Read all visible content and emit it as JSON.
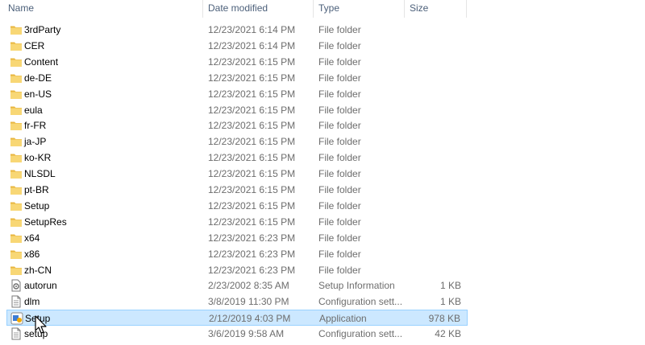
{
  "columns": {
    "name": "Name",
    "date_modified": "Date modified",
    "type": "Type",
    "size": "Size"
  },
  "files": [
    {
      "name": "3rdParty",
      "date": "12/23/2021 6:14 PM",
      "type": "File folder",
      "size": "",
      "icon": "folder-icon"
    },
    {
      "name": "CER",
      "date": "12/23/2021 6:14 PM",
      "type": "File folder",
      "size": "",
      "icon": "folder-icon"
    },
    {
      "name": "Content",
      "date": "12/23/2021 6:15 PM",
      "type": "File folder",
      "size": "",
      "icon": "folder-icon"
    },
    {
      "name": "de-DE",
      "date": "12/23/2021 6:15 PM",
      "type": "File folder",
      "size": "",
      "icon": "folder-icon"
    },
    {
      "name": "en-US",
      "date": "12/23/2021 6:15 PM",
      "type": "File folder",
      "size": "",
      "icon": "folder-icon"
    },
    {
      "name": "eula",
      "date": "12/23/2021 6:15 PM",
      "type": "File folder",
      "size": "",
      "icon": "folder-icon"
    },
    {
      "name": "fr-FR",
      "date": "12/23/2021 6:15 PM",
      "type": "File folder",
      "size": "",
      "icon": "folder-icon"
    },
    {
      "name": "ja-JP",
      "date": "12/23/2021 6:15 PM",
      "type": "File folder",
      "size": "",
      "icon": "folder-icon"
    },
    {
      "name": "ko-KR",
      "date": "12/23/2021 6:15 PM",
      "type": "File folder",
      "size": "",
      "icon": "folder-icon"
    },
    {
      "name": "NLSDL",
      "date": "12/23/2021 6:15 PM",
      "type": "File folder",
      "size": "",
      "icon": "folder-icon"
    },
    {
      "name": "pt-BR",
      "date": "12/23/2021 6:15 PM",
      "type": "File folder",
      "size": "",
      "icon": "folder-icon"
    },
    {
      "name": "Setup",
      "date": "12/23/2021 6:15 PM",
      "type": "File folder",
      "size": "",
      "icon": "folder-icon"
    },
    {
      "name": "SetupRes",
      "date": "12/23/2021 6:15 PM",
      "type": "File folder",
      "size": "",
      "icon": "folder-icon"
    },
    {
      "name": "x64",
      "date": "12/23/2021 6:23 PM",
      "type": "File folder",
      "size": "",
      "icon": "folder-icon"
    },
    {
      "name": "x86",
      "date": "12/23/2021 6:23 PM",
      "type": "File folder",
      "size": "",
      "icon": "folder-icon"
    },
    {
      "name": "zh-CN",
      "date": "12/23/2021 6:23 PM",
      "type": "File folder",
      "size": "",
      "icon": "folder-icon"
    },
    {
      "name": "autorun",
      "date": "2/23/2002 8:35 AM",
      "type": "Setup Information",
      "size": "1 KB",
      "icon": "settings-file-icon"
    },
    {
      "name": "dlm",
      "date": "3/8/2019 11:30 PM",
      "type": "Configuration sett...",
      "size": "1 KB",
      "icon": "config-file-icon"
    },
    {
      "name": "Setup",
      "date": "2/12/2019 4:03 PM",
      "type": "Application",
      "size": "978 KB",
      "icon": "setup-app-icon",
      "selected": true
    },
    {
      "name": "setup",
      "date": "3/6/2019 9:58 AM",
      "type": "Configuration sett...",
      "size": "42 KB",
      "icon": "config-file-icon"
    }
  ],
  "colors": {
    "folder": "#f8d775",
    "selection": "#cce8ff",
    "header_text": "#4c607a"
  }
}
